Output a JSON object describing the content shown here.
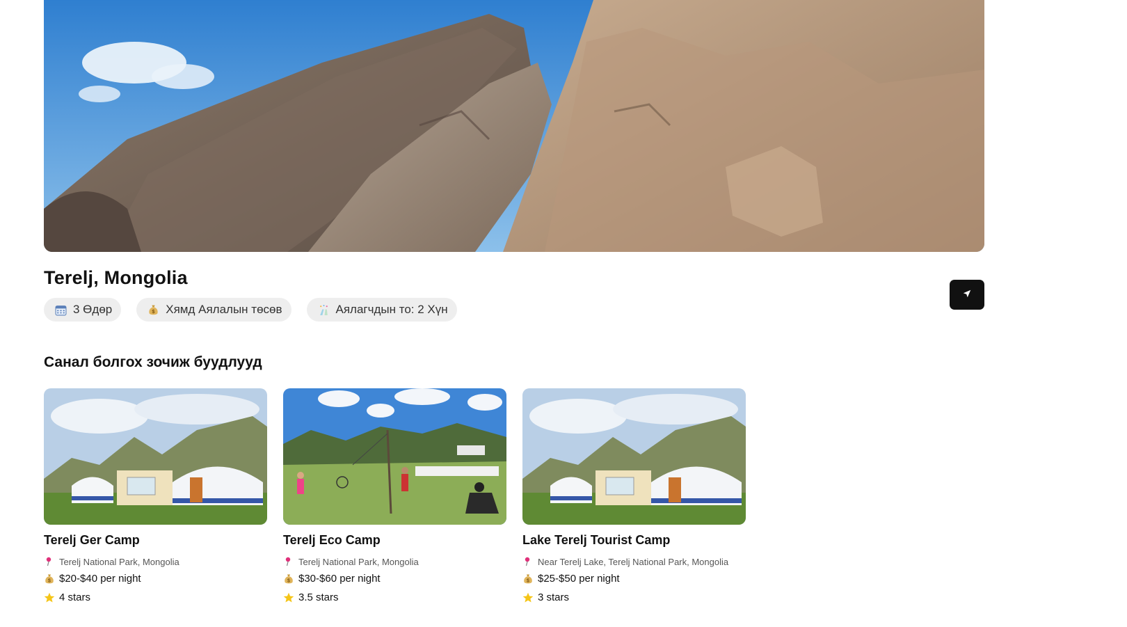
{
  "destination": {
    "title": "Terelj, Mongolia",
    "chips": [
      {
        "icon": "calendar-icon",
        "label": "3 Өдөр"
      },
      {
        "icon": "money-bag-icon",
        "label": "Хямд Аялалын төсөв"
      },
      {
        "icon": "celebration-icon",
        "label": "Аялагчдын то: 2 Хүн"
      }
    ]
  },
  "hotels": {
    "section_title": "Санал болгох зочиж буудлууд",
    "items": [
      {
        "name": "Terelj Ger Camp",
        "location": "Terelj National Park, Mongolia",
        "price": "$20-$40 per night",
        "rating": "4 stars"
      },
      {
        "name": "Terelj Eco Camp",
        "location": "Terelj National Park, Mongolia",
        "price": "$30-$60 per night",
        "rating": "3.5 stars"
      },
      {
        "name": "Lake Terelj Tourist Camp",
        "location": "Near Terelj Lake, Terelj National Park, Mongolia",
        "price": "$25-$50 per night",
        "rating": "3 stars"
      }
    ]
  },
  "icons": {
    "share": "send-icon",
    "location": "pin-icon",
    "price": "money-bag-icon",
    "rating": "star-icon"
  },
  "colors": {
    "chip_bg": "#eeeeee",
    "button_bg": "#111111",
    "pin": "#e0307a",
    "star": "#f5c518"
  }
}
